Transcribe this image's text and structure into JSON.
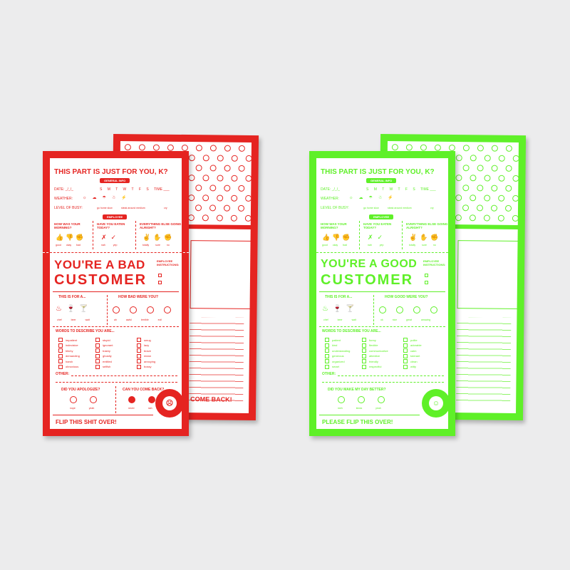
{
  "colors": {
    "red": "#e52421",
    "green": "#5ff028",
    "background": "#ececed"
  },
  "bad_card": {
    "back_footer": "COME BACK!",
    "header": "THIS PART IS JUST FOR YOU, K?",
    "general_info": "GENERAL INFO",
    "date_label": "DATE: _/_/_",
    "days": [
      "S",
      "M",
      "T",
      "W",
      "T",
      "F",
      "S"
    ],
    "time_label": "TIME ___",
    "weather_label": "WEATHER:",
    "busy_label": "LEVEL OF BUSY:",
    "busy_options": [
      "go home slow",
      "steak around medium",
      "cry"
    ],
    "employee": "EMPLOYEE",
    "q1": "HOW WAS YOUR MORNING?",
    "q1_opts": [
      "good",
      "okay",
      "bad"
    ],
    "q2": "HAVE YOU EATEN TODAY?",
    "q2_opts": [
      "nah",
      "yep"
    ],
    "q3": "EVERYTHING ELSE GOING ALRIGHT?",
    "q3_opts": [
      "totally",
      "sure",
      "no"
    ],
    "title_line1": "YOU'RE A BAD",
    "title_line2": "CUSTOMER",
    "instructions": "EMPLOYEE INSTRUCTIONS:",
    "for_label": "THIS IS FOR A...",
    "for_opts": [
      "chef",
      "beer",
      "wait"
    ],
    "how_label": "HOW BAD WERE YOU?",
    "how_opts": [
      "ah",
      "awful",
      "terrible",
      "evil"
    ],
    "words_label": "WORDS TO DESCRIBE YOU ARE...",
    "words_col1": [
      "impatient",
      "indecisive",
      "bitchy",
      "demanding",
      "harsh",
      "obnoxious"
    ],
    "words_col2": [
      "stupid",
      "ignorant",
      "trashy",
      "ghostly",
      "entitled",
      "selfish"
    ],
    "words_col3": [
      "smug",
      "lazy",
      "brave",
      "mean",
      "annoying",
      "bossy"
    ],
    "other_label": "OTHER:",
    "q4": "DID YOU APOLOGIZE?",
    "q4_opts": [
      "nope",
      "yeah"
    ],
    "q5": "CAN YOU COME BACK?",
    "q5_opts": [
      "never",
      "nah"
    ],
    "footer": "FLIP THIS SHIT OVER!",
    "seal_text": "COMPLAIN. CO."
  },
  "good_card": {
    "header": "THIS PART IS JUST FOR YOU, K?",
    "general_info": "GENERAL INFO",
    "date_label": "DATE: _/_/_",
    "days": [
      "S",
      "M",
      "T",
      "W",
      "T",
      "F",
      "S"
    ],
    "time_label": "TIME ___",
    "weather_label": "WEATHER:",
    "busy_label": "LEVEL OF BUSY:",
    "busy_options": [
      "go home slow",
      "steak around medium",
      "cry"
    ],
    "employee": "EMPLOYEE",
    "q1": "HOW WAS YOUR MORNING?",
    "q1_opts": [
      "good",
      "okay",
      "bad"
    ],
    "q2": "HAVE YOU EATEN TODAY?",
    "q2_opts": [
      "nah",
      "yep"
    ],
    "q3": "EVERYTHING ELSE GOING ALRIGHT?",
    "q3_opts": [
      "totally",
      "sure",
      "no"
    ],
    "title_line1": "YOU'RE A GOOD",
    "title_line2": "CUSTOMER",
    "instructions": "EMPLOYEE INSTRUCTIONS:",
    "for_label": "THIS IS FOR A...",
    "for_opts": [
      "chef",
      "beer",
      "wait"
    ],
    "how_label": "HOW GOOD WERE YOU?",
    "how_opts": [
      "ok",
      "nice",
      "great",
      "amazing"
    ],
    "words_label": "WORDS TO DESCRIBE YOU ARE...",
    "words_col1": [
      "patient",
      "kind",
      "understanding",
      "generous",
      "organized",
      "smart"
    ],
    "words_col2": [
      "funny",
      "flexible",
      "communicative",
      "attentive",
      "friendly",
      "respectful"
    ],
    "words_col3": [
      "polite",
      "adorable",
      "calm",
      "tolerant",
      "clean",
      "witty"
    ],
    "other_label": "OTHER:",
    "q4": "DID YOU MAKE MY DAY BETTER?",
    "q4_opts": [
      "meh",
      "kinda",
      "yeah"
    ],
    "footer": "PLEASE FLIP THIS OVER!",
    "seal_text": "COMPLAIN. CO."
  }
}
